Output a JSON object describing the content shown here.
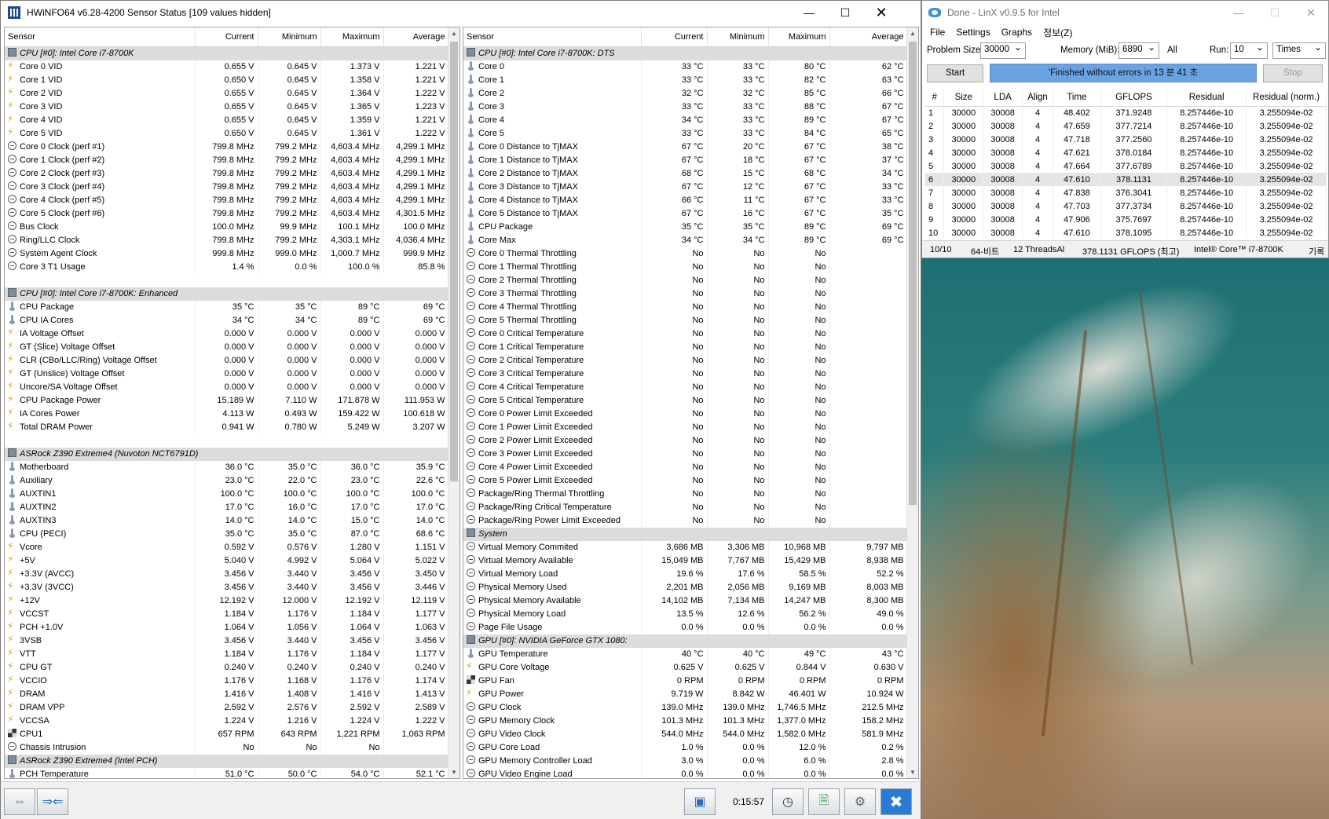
{
  "hwinfo": {
    "title": "HWiNFO64 v6.28-4200 Sensor Status [109 values hidden]",
    "columns": [
      "Sensor",
      "Current",
      "Minimum",
      "Maximum",
      "Average"
    ],
    "timer": "0:15:57",
    "left": [
      {
        "g": "CPU [#0]: Intel Core i7-8700K"
      },
      {
        "i": "volt",
        "n": "Core 0 VID",
        "c": "0.655 V",
        "mn": "0.645 V",
        "mx": "1.373 V",
        "a": "1.221 V"
      },
      {
        "i": "volt",
        "n": "Core 1 VID",
        "c": "0.650 V",
        "mn": "0.645 V",
        "mx": "1.358 V",
        "a": "1.221 V"
      },
      {
        "i": "volt",
        "n": "Core 2 VID",
        "c": "0.655 V",
        "mn": "0.645 V",
        "mx": "1.364 V",
        "a": "1.222 V"
      },
      {
        "i": "volt",
        "n": "Core 3 VID",
        "c": "0.655 V",
        "mn": "0.645 V",
        "mx": "1.365 V",
        "a": "1.223 V"
      },
      {
        "i": "volt",
        "n": "Core 4 VID",
        "c": "0.655 V",
        "mn": "0.645 V",
        "mx": "1.359 V",
        "a": "1.221 V"
      },
      {
        "i": "volt",
        "n": "Core 5 VID",
        "c": "0.650 V",
        "mn": "0.645 V",
        "mx": "1.361 V",
        "a": "1.222 V"
      },
      {
        "i": "clock",
        "n": "Core 0 Clock (perf #1)",
        "c": "799.8 MHz",
        "mn": "799.2 MHz",
        "mx": "4,603.4 MHz",
        "a": "4,299.1 MHz"
      },
      {
        "i": "clock",
        "n": "Core 1 Clock (perf #2)",
        "c": "799.8 MHz",
        "mn": "799.2 MHz",
        "mx": "4,603.4 MHz",
        "a": "4,299.1 MHz"
      },
      {
        "i": "clock",
        "n": "Core 2 Clock (perf #3)",
        "c": "799.8 MHz",
        "mn": "799.2 MHz",
        "mx": "4,603.4 MHz",
        "a": "4,299.1 MHz"
      },
      {
        "i": "clock",
        "n": "Core 3 Clock (perf #4)",
        "c": "799.8 MHz",
        "mn": "799.2 MHz",
        "mx": "4,603.4 MHz",
        "a": "4,299.1 MHz"
      },
      {
        "i": "clock",
        "n": "Core 4 Clock (perf #5)",
        "c": "799.8 MHz",
        "mn": "799.2 MHz",
        "mx": "4,603.4 MHz",
        "a": "4,299.1 MHz"
      },
      {
        "i": "clock",
        "n": "Core 5 Clock (perf #6)",
        "c": "799.8 MHz",
        "mn": "799.2 MHz",
        "mx": "4,603.4 MHz",
        "a": "4,301.5 MHz"
      },
      {
        "i": "clock",
        "n": "Bus Clock",
        "c": "100.0 MHz",
        "mn": "99.9 MHz",
        "mx": "100.1 MHz",
        "a": "100.0 MHz"
      },
      {
        "i": "clock",
        "n": "Ring/LLC Clock",
        "c": "799.8 MHz",
        "mn": "799.2 MHz",
        "mx": "4,303.1 MHz",
        "a": "4,036.4 MHz"
      },
      {
        "i": "clock",
        "n": "System Agent Clock",
        "c": "999.8 MHz",
        "mn": "999.0 MHz",
        "mx": "1,000.7 MHz",
        "a": "999.9 MHz"
      },
      {
        "i": "clock",
        "n": "Core 3 T1 Usage",
        "c": "1.4 %",
        "mn": "0.0 %",
        "mx": "100.0 %",
        "a": "85.8 %"
      },
      {
        "blank": true
      },
      {
        "g": "CPU [#0]: Intel Core i7-8700K: Enhanced"
      },
      {
        "i": "temp",
        "n": "CPU Package",
        "c": "35 °C",
        "mn": "35 °C",
        "mx": "89 °C",
        "a": "69 °C"
      },
      {
        "i": "temp",
        "n": "CPU IA Cores",
        "c": "34 °C",
        "mn": "34 °C",
        "mx": "89 °C",
        "a": "69 °C"
      },
      {
        "i": "volt",
        "n": "IA Voltage Offset",
        "c": "0.000 V",
        "mn": "0.000 V",
        "mx": "0.000 V",
        "a": "0.000 V"
      },
      {
        "i": "volt",
        "n": "GT (Slice) Voltage Offset",
        "c": "0.000 V",
        "mn": "0.000 V",
        "mx": "0.000 V",
        "a": "0.000 V"
      },
      {
        "i": "volt",
        "n": "CLR (CBo/LLC/Ring) Voltage Offset",
        "c": "0.000 V",
        "mn": "0.000 V",
        "mx": "0.000 V",
        "a": "0.000 V"
      },
      {
        "i": "volt",
        "n": "GT (Unslice) Voltage Offset",
        "c": "0.000 V",
        "mn": "0.000 V",
        "mx": "0.000 V",
        "a": "0.000 V"
      },
      {
        "i": "volt",
        "n": "Uncore/SA Voltage Offset",
        "c": "0.000 V",
        "mn": "0.000 V",
        "mx": "0.000 V",
        "a": "0.000 V"
      },
      {
        "i": "volt",
        "n": "CPU Package Power",
        "c": "15.189 W",
        "mn": "7.110 W",
        "mx": "171.878 W",
        "a": "111.953 W"
      },
      {
        "i": "volt",
        "n": "IA Cores Power",
        "c": "4.113 W",
        "mn": "0.493 W",
        "mx": "159.422 W",
        "a": "100.618 W"
      },
      {
        "i": "volt",
        "n": "Total DRAM Power",
        "c": "0.941 W",
        "mn": "0.780 W",
        "mx": "5.249 W",
        "a": "3.207 W"
      },
      {
        "blank": true
      },
      {
        "g": "ASRock Z390 Extreme4 (Nuvoton NCT6791D)"
      },
      {
        "i": "temp",
        "n": "Motherboard",
        "c": "36.0 °C",
        "mn": "35.0 °C",
        "mx": "36.0 °C",
        "a": "35.9 °C"
      },
      {
        "i": "temp",
        "n": "Auxiliary",
        "c": "23.0 °C",
        "mn": "22.0 °C",
        "mx": "23.0 °C",
        "a": "22.6 °C"
      },
      {
        "i": "temp",
        "n": "AUXTIN1",
        "c": "100.0 °C",
        "mn": "100.0 °C",
        "mx": "100.0 °C",
        "a": "100.0 °C"
      },
      {
        "i": "temp",
        "n": "AUXTIN2",
        "c": "17.0 °C",
        "mn": "16.0 °C",
        "mx": "17.0 °C",
        "a": "17.0 °C"
      },
      {
        "i": "temp",
        "n": "AUXTIN3",
        "c": "14.0 °C",
        "mn": "14.0 °C",
        "mx": "15.0 °C",
        "a": "14.0 °C"
      },
      {
        "i": "temp",
        "n": "CPU (PECI)",
        "c": "35.0 °C",
        "mn": "35.0 °C",
        "mx": "87.0 °C",
        "a": "68.6 °C"
      },
      {
        "i": "volt",
        "n": "Vcore",
        "c": "0.592 V",
        "mn": "0.576 V",
        "mx": "1.280 V",
        "a": "1.151 V"
      },
      {
        "i": "volt",
        "n": "+5V",
        "c": "5.040 V",
        "mn": "4.992 V",
        "mx": "5.064 V",
        "a": "5.022 V"
      },
      {
        "i": "volt",
        "n": "+3.3V (AVCC)",
        "c": "3.456 V",
        "mn": "3.440 V",
        "mx": "3.456 V",
        "a": "3.450 V"
      },
      {
        "i": "volt",
        "n": "+3.3V (3VCC)",
        "c": "3.456 V",
        "mn": "3.440 V",
        "mx": "3.456 V",
        "a": "3.446 V"
      },
      {
        "i": "volt",
        "n": "+12V",
        "c": "12.192 V",
        "mn": "12.000 V",
        "mx": "12.192 V",
        "a": "12.119 V"
      },
      {
        "i": "volt",
        "n": "VCCST",
        "c": "1.184 V",
        "mn": "1.176 V",
        "mx": "1.184 V",
        "a": "1.177 V"
      },
      {
        "i": "volt",
        "n": "PCH +1.0V",
        "c": "1.064 V",
        "mn": "1.056 V",
        "mx": "1.064 V",
        "a": "1.063 V"
      },
      {
        "i": "volt",
        "n": "3VSB",
        "c": "3.456 V",
        "mn": "3.440 V",
        "mx": "3.456 V",
        "a": "3.456 V"
      },
      {
        "i": "volt",
        "n": "VTT",
        "c": "1.184 V",
        "mn": "1.176 V",
        "mx": "1.184 V",
        "a": "1.177 V"
      },
      {
        "i": "volt",
        "n": "CPU GT",
        "c": "0.240 V",
        "mn": "0.240 V",
        "mx": "0.240 V",
        "a": "0.240 V"
      },
      {
        "i": "volt",
        "n": "VCCIO",
        "c": "1.176 V",
        "mn": "1.168 V",
        "mx": "1.176 V",
        "a": "1.174 V"
      },
      {
        "i": "volt",
        "n": "DRAM",
        "c": "1.416 V",
        "mn": "1.408 V",
        "mx": "1.416 V",
        "a": "1.413 V"
      },
      {
        "i": "volt",
        "n": "DRAM VPP",
        "c": "2.592 V",
        "mn": "2.576 V",
        "mx": "2.592 V",
        "a": "2.589 V"
      },
      {
        "i": "volt",
        "n": "VCCSA",
        "c": "1.224 V",
        "mn": "1.216 V",
        "mx": "1.224 V",
        "a": "1.222 V"
      },
      {
        "i": "fan",
        "n": "CPU1",
        "c": "657 RPM",
        "mn": "643 RPM",
        "mx": "1,221 RPM",
        "a": "1,063 RPM"
      },
      {
        "i": "clock",
        "n": "Chassis Intrusion",
        "c": "No",
        "mn": "No",
        "mx": "No",
        "a": ""
      },
      {
        "g": "ASRock Z390 Extreme4 (Intel PCH)"
      },
      {
        "i": "temp",
        "n": "PCH Temperature",
        "c": "51.0 °C",
        "mn": "50.0 °C",
        "mx": "54.0 °C",
        "a": "52.1 °C"
      }
    ],
    "right": [
      {
        "g": "CPU [#0]: Intel Core i7-8700K: DTS"
      },
      {
        "i": "temp",
        "n": "Core 0",
        "c": "33 °C",
        "mn": "33 °C",
        "mx": "80 °C",
        "a": "62 °C"
      },
      {
        "i": "temp",
        "n": "Core 1",
        "c": "33 °C",
        "mn": "33 °C",
        "mx": "82 °C",
        "a": "63 °C"
      },
      {
        "i": "temp",
        "n": "Core 2",
        "c": "32 °C",
        "mn": "32 °C",
        "mx": "85 °C",
        "a": "66 °C"
      },
      {
        "i": "temp",
        "n": "Core 3",
        "c": "33 °C",
        "mn": "33 °C",
        "mx": "88 °C",
        "a": "67 °C"
      },
      {
        "i": "temp",
        "n": "Core 4",
        "c": "34 °C",
        "mn": "33 °C",
        "mx": "89 °C",
        "a": "67 °C"
      },
      {
        "i": "temp",
        "n": "Core 5",
        "c": "33 °C",
        "mn": "33 °C",
        "mx": "84 °C",
        "a": "65 °C"
      },
      {
        "i": "temp",
        "n": "Core 0 Distance to TjMAX",
        "c": "67 °C",
        "mn": "20 °C",
        "mx": "67 °C",
        "a": "38 °C"
      },
      {
        "i": "temp",
        "n": "Core 1 Distance to TjMAX",
        "c": "67 °C",
        "mn": "18 °C",
        "mx": "67 °C",
        "a": "37 °C"
      },
      {
        "i": "temp",
        "n": "Core 2 Distance to TjMAX",
        "c": "68 °C",
        "mn": "15 °C",
        "mx": "68 °C",
        "a": "34 °C"
      },
      {
        "i": "temp",
        "n": "Core 3 Distance to TjMAX",
        "c": "67 °C",
        "mn": "12 °C",
        "mx": "67 °C",
        "a": "33 °C"
      },
      {
        "i": "temp",
        "n": "Core 4 Distance to TjMAX",
        "c": "66 °C",
        "mn": "11 °C",
        "mx": "67 °C",
        "a": "33 °C"
      },
      {
        "i": "temp",
        "n": "Core 5 Distance to TjMAX",
        "c": "67 °C",
        "mn": "16 °C",
        "mx": "67 °C",
        "a": "35 °C"
      },
      {
        "i": "temp",
        "n": "CPU Package",
        "c": "35 °C",
        "mn": "35 °C",
        "mx": "89 °C",
        "a": "69 °C"
      },
      {
        "i": "temp",
        "n": "Core Max",
        "c": "34 °C",
        "mn": "34 °C",
        "mx": "89 °C",
        "a": "69 °C"
      },
      {
        "i": "clock",
        "n": "Core 0 Thermal Throttling",
        "c": "No",
        "mn": "No",
        "mx": "No",
        "a": ""
      },
      {
        "i": "clock",
        "n": "Core 1 Thermal Throttling",
        "c": "No",
        "mn": "No",
        "mx": "No",
        "a": ""
      },
      {
        "i": "clock",
        "n": "Core 2 Thermal Throttling",
        "c": "No",
        "mn": "No",
        "mx": "No",
        "a": ""
      },
      {
        "i": "clock",
        "n": "Core 3 Thermal Throttling",
        "c": "No",
        "mn": "No",
        "mx": "No",
        "a": ""
      },
      {
        "i": "clock",
        "n": "Core 4 Thermal Throttling",
        "c": "No",
        "mn": "No",
        "mx": "No",
        "a": ""
      },
      {
        "i": "clock",
        "n": "Core 5 Thermal Throttling",
        "c": "No",
        "mn": "No",
        "mx": "No",
        "a": ""
      },
      {
        "i": "clock",
        "n": "Core 0 Critical Temperature",
        "c": "No",
        "mn": "No",
        "mx": "No",
        "a": ""
      },
      {
        "i": "clock",
        "n": "Core 1 Critical Temperature",
        "c": "No",
        "mn": "No",
        "mx": "No",
        "a": ""
      },
      {
        "i": "clock",
        "n": "Core 2 Critical Temperature",
        "c": "No",
        "mn": "No",
        "mx": "No",
        "a": ""
      },
      {
        "i": "clock",
        "n": "Core 3 Critical Temperature",
        "c": "No",
        "mn": "No",
        "mx": "No",
        "a": ""
      },
      {
        "i": "clock",
        "n": "Core 4 Critical Temperature",
        "c": "No",
        "mn": "No",
        "mx": "No",
        "a": ""
      },
      {
        "i": "clock",
        "n": "Core 5 Critical Temperature",
        "c": "No",
        "mn": "No",
        "mx": "No",
        "a": ""
      },
      {
        "i": "clock",
        "n": "Core 0 Power Limit Exceeded",
        "c": "No",
        "mn": "No",
        "mx": "No",
        "a": ""
      },
      {
        "i": "clock",
        "n": "Core 1 Power Limit Exceeded",
        "c": "No",
        "mn": "No",
        "mx": "No",
        "a": ""
      },
      {
        "i": "clock",
        "n": "Core 2 Power Limit Exceeded",
        "c": "No",
        "mn": "No",
        "mx": "No",
        "a": ""
      },
      {
        "i": "clock",
        "n": "Core 3 Power Limit Exceeded",
        "c": "No",
        "mn": "No",
        "mx": "No",
        "a": ""
      },
      {
        "i": "clock",
        "n": "Core 4 Power Limit Exceeded",
        "c": "No",
        "mn": "No",
        "mx": "No",
        "a": ""
      },
      {
        "i": "clock",
        "n": "Core 5 Power Limit Exceeded",
        "c": "No",
        "mn": "No",
        "mx": "No",
        "a": ""
      },
      {
        "i": "clock",
        "n": "Package/Ring Thermal Throttling",
        "c": "No",
        "mn": "No",
        "mx": "No",
        "a": ""
      },
      {
        "i": "clock",
        "n": "Package/Ring Critical Temperature",
        "c": "No",
        "mn": "No",
        "mx": "No",
        "a": ""
      },
      {
        "i": "clock",
        "n": "Package/Ring Power Limit Exceeded",
        "c": "No",
        "mn": "No",
        "mx": "No",
        "a": ""
      },
      {
        "g": "System"
      },
      {
        "i": "clock",
        "n": "Virtual Memory Commited",
        "c": "3,686 MB",
        "mn": "3,306 MB",
        "mx": "10,968 MB",
        "a": "9,797 MB"
      },
      {
        "i": "clock",
        "n": "Virtual Memory Available",
        "c": "15,049 MB",
        "mn": "7,767 MB",
        "mx": "15,429 MB",
        "a": "8,938 MB"
      },
      {
        "i": "clock",
        "n": "Virtual Memory Load",
        "c": "19.6 %",
        "mn": "17.6 %",
        "mx": "58.5 %",
        "a": "52.2 %"
      },
      {
        "i": "clock",
        "n": "Physical Memory Used",
        "c": "2,201 MB",
        "mn": "2,056 MB",
        "mx": "9,169 MB",
        "a": "8,003 MB"
      },
      {
        "i": "clock",
        "n": "Physical Memory Available",
        "c": "14,102 MB",
        "mn": "7,134 MB",
        "mx": "14,247 MB",
        "a": "8,300 MB"
      },
      {
        "i": "clock",
        "n": "Physical Memory Load",
        "c": "13.5 %",
        "mn": "12.6 %",
        "mx": "56.2 %",
        "a": "49.0 %"
      },
      {
        "i": "clock",
        "n": "Page File Usage",
        "c": "0.0 %",
        "mn": "0.0 %",
        "mx": "0.0 %",
        "a": "0.0 %"
      },
      {
        "g": "GPU [#0]: NVIDIA GeForce GTX 1080:"
      },
      {
        "i": "temp",
        "n": "GPU Temperature",
        "c": "40 °C",
        "mn": "40 °C",
        "mx": "49 °C",
        "a": "43 °C"
      },
      {
        "i": "volt",
        "n": "GPU Core Voltage",
        "c": "0.625 V",
        "mn": "0.625 V",
        "mx": "0.844 V",
        "a": "0.630 V"
      },
      {
        "i": "fan",
        "n": "GPU Fan",
        "c": "0 RPM",
        "mn": "0 RPM",
        "mx": "0 RPM",
        "a": "0 RPM"
      },
      {
        "i": "volt",
        "n": "GPU Power",
        "c": "9.719 W",
        "mn": "8.842 W",
        "mx": "46.401 W",
        "a": "10.924 W"
      },
      {
        "i": "clock",
        "n": "GPU Clock",
        "c": "139.0 MHz",
        "mn": "139.0 MHz",
        "mx": "1,746.5 MHz",
        "a": "212.5 MHz"
      },
      {
        "i": "clock",
        "n": "GPU Memory Clock",
        "c": "101.3 MHz",
        "mn": "101.3 MHz",
        "mx": "1,377.0 MHz",
        "a": "158.2 MHz"
      },
      {
        "i": "clock",
        "n": "GPU Video Clock",
        "c": "544.0 MHz",
        "mn": "544.0 MHz",
        "mx": "1,582.0 MHz",
        "a": "581.9 MHz"
      },
      {
        "i": "clock",
        "n": "GPU Core Load",
        "c": "1.0 %",
        "mn": "0.0 %",
        "mx": "12.0 %",
        "a": "0.2 %"
      },
      {
        "i": "clock",
        "n": "GPU Memory Controller Load",
        "c": "3.0 %",
        "mn": "0.0 %",
        "mx": "6.0 %",
        "a": "2.8 %"
      },
      {
        "i": "clock",
        "n": "GPU Video Engine Load",
        "c": "0.0 %",
        "mn": "0.0 %",
        "mx": "0.0 %",
        "a": "0.0 %"
      }
    ]
  },
  "linx": {
    "title": "Done - LinX v0.9.5 for Intel",
    "menu": [
      "File",
      "Settings",
      "Graphs",
      "정보(Z)"
    ],
    "problem_size_label": "Problem Size:",
    "problem_size": "30000",
    "memory_label": "Memory (MiB):",
    "memory": "6890",
    "all_label": "All",
    "run_label": "Run:",
    "run": "10",
    "run_unit": "Times",
    "start": "Start",
    "stop": "Stop",
    "status": "'Finished without errors in 13 분 41 초",
    "columns": [
      "#",
      "Size",
      "LDA",
      "Align",
      "Time",
      "GFLOPS",
      "Residual",
      "Residual (norm.)"
    ],
    "rows": [
      [
        "1",
        "30000",
        "30008",
        "4",
        "48.402",
        "371.9248",
        "8.257446e-10",
        "3.255094e-02"
      ],
      [
        "2",
        "30000",
        "30008",
        "4",
        "47.659",
        "377.7214",
        "8.257446e-10",
        "3.255094e-02"
      ],
      [
        "3",
        "30000",
        "30008",
        "4",
        "47.718",
        "377.2560",
        "8.257446e-10",
        "3.255094e-02"
      ],
      [
        "4",
        "30000",
        "30008",
        "4",
        "47.621",
        "378.0184",
        "8.257446e-10",
        "3.255094e-02"
      ],
      [
        "5",
        "30000",
        "30008",
        "4",
        "47.664",
        "377.6789",
        "8.257446e-10",
        "3.255094e-02"
      ],
      [
        "6",
        "30000",
        "30008",
        "4",
        "47.610",
        "378.1131",
        "8.257446e-10",
        "3.255094e-02"
      ],
      [
        "7",
        "30000",
        "30008",
        "4",
        "47.838",
        "376.3041",
        "8.257446e-10",
        "3.255094e-02"
      ],
      [
        "8",
        "30000",
        "30008",
        "4",
        "47.703",
        "377.3734",
        "8.257446e-10",
        "3.255094e-02"
      ],
      [
        "9",
        "30000",
        "30008",
        "4",
        "47.906",
        "375.7697",
        "8.257446e-10",
        "3.255094e-02"
      ],
      [
        "10",
        "30000",
        "30008",
        "4",
        "47.610",
        "378.1095",
        "8.257446e-10",
        "3.255094e-02"
      ]
    ],
    "selected_row": 6,
    "footer": {
      "progress": "10/10",
      "bits": "64-비트",
      "threads": "12 ThreadsAl",
      "gflops": "378.1131 GFLOPS (최고)",
      "cpu": "Intel® Core™ i7-8700K",
      "log": "기록"
    }
  }
}
